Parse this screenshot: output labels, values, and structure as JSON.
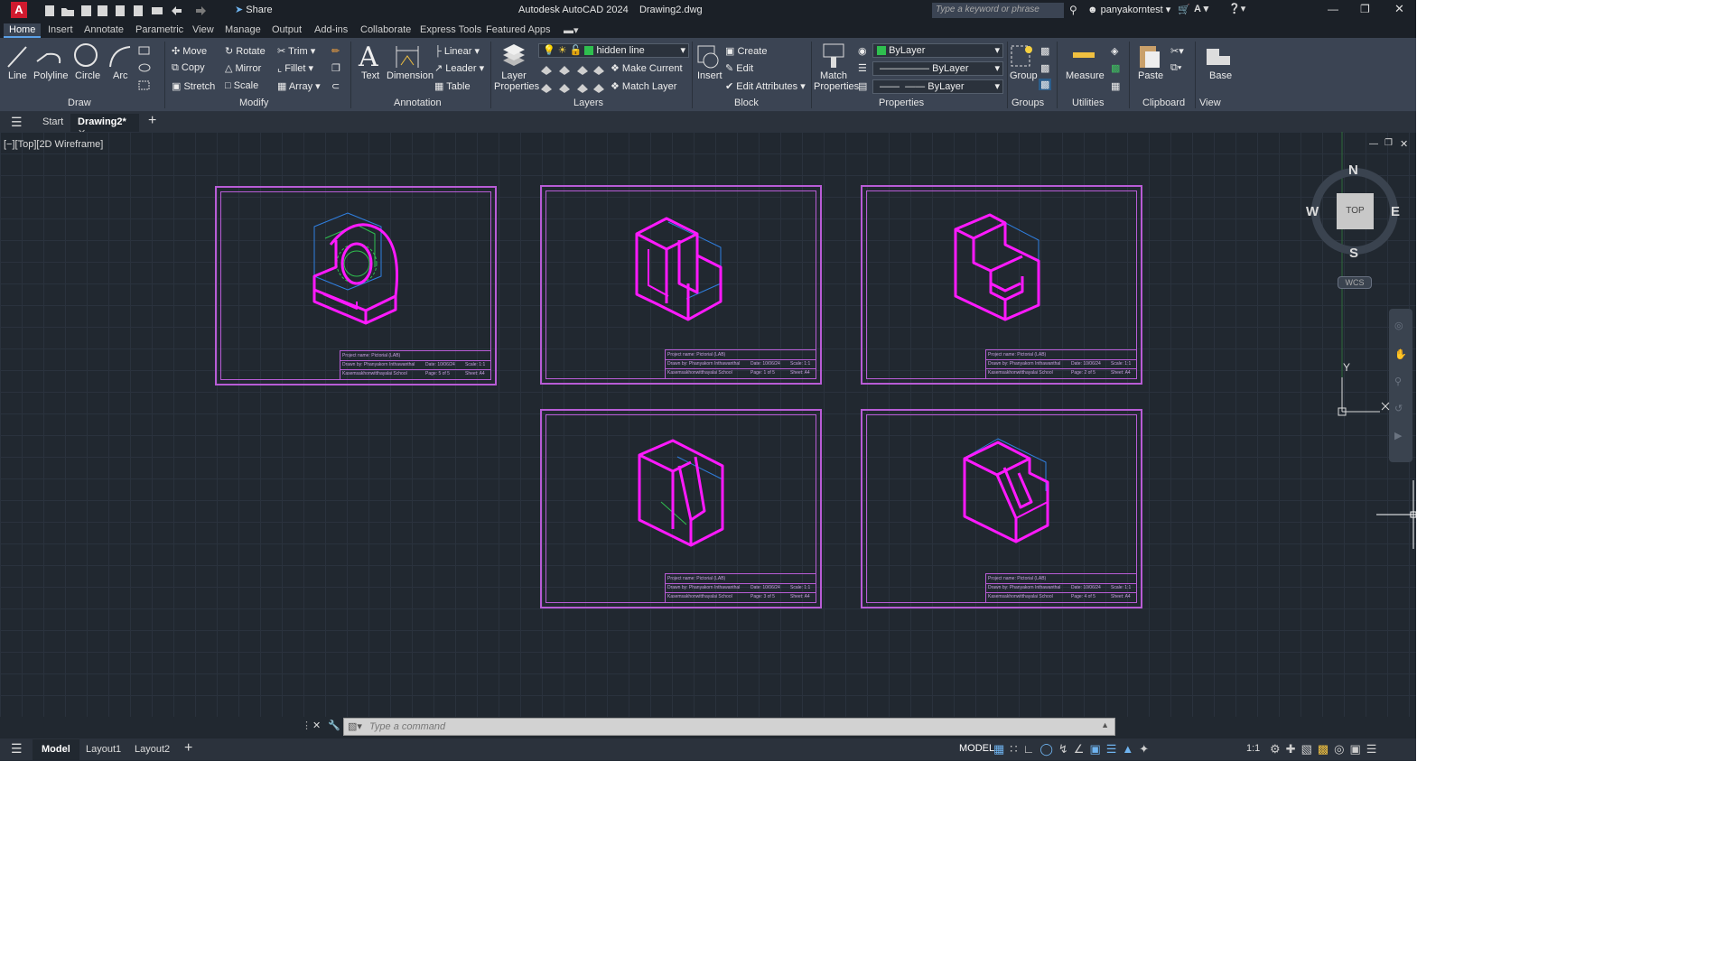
{
  "window": {
    "title": "Autodesk AutoCAD 2024",
    "filename": "Drawing2.dwg",
    "share_label": "Share",
    "search_placeholder": "Type a keyword or phrase",
    "user": "panyakorntest"
  },
  "ribbon_tabs": [
    "Home",
    "Insert",
    "Annotate",
    "Parametric",
    "View",
    "Manage",
    "Output",
    "Add-ins",
    "Collaborate",
    "Express Tools",
    "Featured Apps"
  ],
  "draw": {
    "line": "Line",
    "polyline": "Polyline",
    "circle": "Circle",
    "arc": "Arc",
    "title": "Draw"
  },
  "modify": {
    "move": "Move",
    "rotate": "Rotate",
    "trim": "Trim",
    "copy": "Copy",
    "mirror": "Mirror",
    "fillet": "Fillet",
    "stretch": "Stretch",
    "scale": "Scale",
    "array": "Array",
    "title": "Modify"
  },
  "annotation": {
    "text": "Text",
    "dimension": "Dimension",
    "linear": "Linear",
    "leader": "Leader",
    "table": "Table",
    "title": "Annotation"
  },
  "layers": {
    "layer_properties": "Layer Properties",
    "current_layer": "hidden line",
    "make_current": "Make Current",
    "match_layer": "Match Layer",
    "title": "Layers"
  },
  "block": {
    "insert": "Insert",
    "create": "Create",
    "edit": "Edit",
    "edit_attributes": "Edit Attributes",
    "title": "Block"
  },
  "properties": {
    "match": "Match Properties",
    "color": "ByLayer",
    "linetype": "ByLayer",
    "lineweight": "ByLayer",
    "title": "Properties"
  },
  "groups": {
    "group": "Group",
    "title": "Groups"
  },
  "utilities": {
    "measure": "Measure",
    "title": "Utilities"
  },
  "clipboard": {
    "paste": "Paste",
    "title": "Clipboard"
  },
  "view": {
    "base": "Base",
    "title": "View"
  },
  "doc_tabs": {
    "start": "Start",
    "drawing": "Drawing2*"
  },
  "viewport_label": "[−][Top][2D Wireframe]",
  "viewcube": {
    "n": "N",
    "s": "S",
    "e": "E",
    "w": "W",
    "top": "TOP",
    "wcs": "WCS"
  },
  "ucs": {
    "y": "Y",
    "x": "X"
  },
  "command_placeholder": "Type a command",
  "layout_tabs": {
    "model": "Model",
    "layout1": "Layout1",
    "layout2": "Layout2"
  },
  "status": {
    "model": "MODEL",
    "scale": "1:1"
  },
  "sheets": [
    {
      "project": "Project name: Pictorial (LAB)",
      "drawn": "Drawn by: Phanyakorn Inthawanthal",
      "date": "Date: 10/06/24",
      "scale": "Scale: 1:1",
      "school": "Kasemsakhonwitthayalai School",
      "page": "Page: 5 of 5",
      "sheet": "Sheet: A4"
    },
    {
      "project": "Project name: Pictorial (LAB)",
      "drawn": "Drawn by: Phanyakorn Inthawanthal",
      "date": "Date: 10/06/24",
      "scale": "Scale: 1:1",
      "school": "Kasemsakhonwitthayalai School",
      "page": "Page: 1 of 5",
      "sheet": "Sheet: A4"
    },
    {
      "project": "Project name: Pictorial (LAB)",
      "drawn": "Drawn by: Phanyakorn Inthawanthal",
      "date": "Date: 10/06/24",
      "scale": "Scale: 1:1",
      "school": "Kasemsakhonwitthayalai School",
      "page": "Page: 2 of 5",
      "sheet": "Sheet: A4"
    },
    {
      "project": "Project name: Pictorial (LAB)",
      "drawn": "Drawn by: Phanyakorn Inthawanthal",
      "date": "Date: 10/06/24",
      "scale": "Scale: 1:1",
      "school": "Kasemsakhonwitthayalai School",
      "page": "Page: 3 of 5",
      "sheet": "Sheet: A4"
    },
    {
      "project": "Project name: Pictorial (LAB)",
      "drawn": "Drawn by: Phanyakorn Inthawanthal",
      "date": "Date: 10/06/24",
      "scale": "Scale: 1:1",
      "school": "Kasemsakhonwitthayalai School",
      "page": "Page: 4 of 5",
      "sheet": "Sheet: A4"
    }
  ],
  "colors": {
    "accent": "#5aa0e6",
    "magenta": "#ff19ff",
    "sheet_border": "#b85cd6",
    "hidden_blue": "#2f7fe0",
    "green": "#2fbf4f",
    "app_logo": "#d01a2e"
  }
}
